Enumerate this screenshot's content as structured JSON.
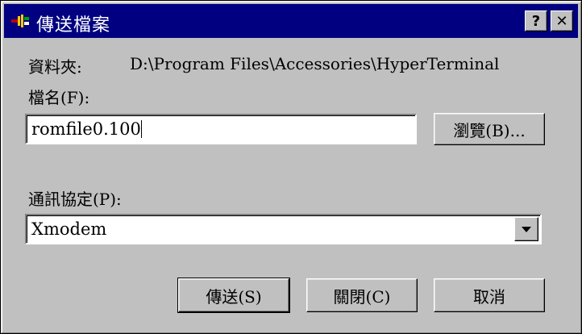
{
  "window": {
    "title": "傳送檔案",
    "help_label": "?",
    "close_label": "✕"
  },
  "folder": {
    "label": "資料夾:",
    "path": "D:\\Program Files\\Accessories\\HyperTerminal"
  },
  "filename": {
    "label": "檔名(F):",
    "value": "romfile0.100",
    "browse_label": "瀏覽(B)..."
  },
  "protocol": {
    "label": "通訊協定(P):",
    "selected": "Xmodem"
  },
  "buttons": {
    "send": "傳送(S)",
    "close": "關閉(C)",
    "cancel": "取消"
  },
  "icons": {
    "app": "hyperterminal-icon",
    "dropdown": "chevron-down-icon"
  },
  "colors": {
    "titlebar": "#000080",
    "face": "#c0c0c0"
  }
}
